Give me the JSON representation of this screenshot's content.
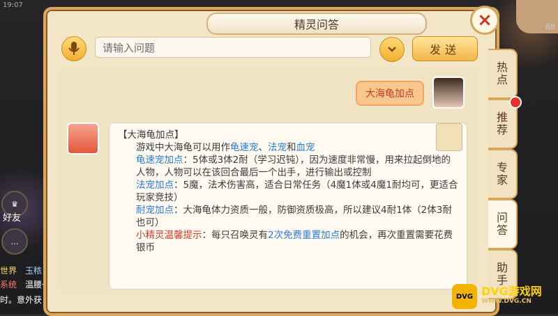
{
  "hud": {
    "time": "19:07",
    "friends_label": "好友",
    "chat_lines": [
      "世界",
      "系统",
      "时。意外获"
    ],
    "chat_tags": [
      "玉秾",
      "温腰一"
    ],
    "right_number": "88"
  },
  "dialog": {
    "title": "精灵问答",
    "close_icon": "×"
  },
  "search": {
    "placeholder": "请输入问题",
    "send_label": "发送"
  },
  "chat": {
    "user_message": "大海龟加点",
    "answer": {
      "heading": "【大海龟加点】",
      "intro_prefix": "游戏中大海龟可以用作",
      "intro_link1": "龟速宠",
      "intro_sep": "、",
      "intro_link2": "法宠",
      "intro_and": "和",
      "intro_link3": "血宠",
      "p1_label": "龟速宠加点",
      "p1_text": "：5体或3体2耐（学习迟钝），因为速度非常慢，用来拉起倒地的人物，人物可以在该回合最后一个出手，进行输出或控制",
      "p2_label": "法宠加点",
      "p2_text": "：5魔，法术伤害高，适合日常任务（4魔1体或4魔1耐均可，更适合玩家竞技）",
      "p3_label": "耐宠加点",
      "p3_text": "：大海龟体力资质一般，防御资质极高，所以建议4耐1体（2体3耐也可）",
      "tip_label": "小精灵温馨提示",
      "tip_text1": "：每只召唤灵有",
      "tip_link": "2次免费重置加点",
      "tip_text2": "的机会，再次重置需要花费银币"
    }
  },
  "tabs": [
    {
      "line1": "热",
      "line2": "点"
    },
    {
      "line1": "推",
      "line2": "荐"
    },
    {
      "line1": "专",
      "line2": "家"
    },
    {
      "line1": "问",
      "line2": "答"
    },
    {
      "line1": "助",
      "line2": "手"
    }
  ],
  "watermark": {
    "icon": "DVG",
    "title": "DVG游戏网",
    "url": "WWW.DVG.CN"
  }
}
